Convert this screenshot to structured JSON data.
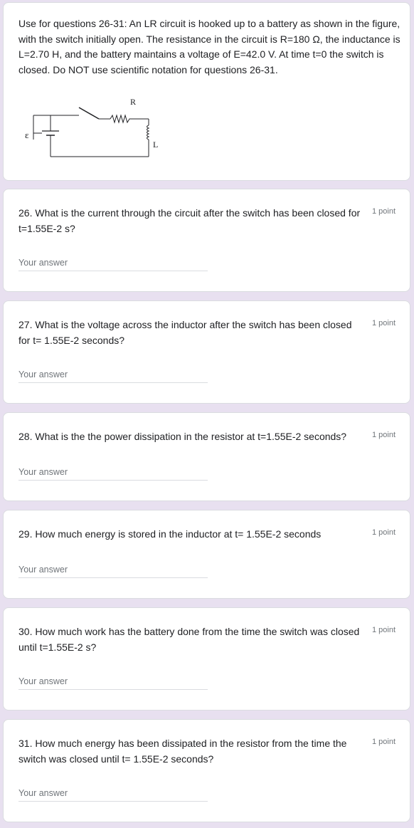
{
  "intro": {
    "text": "Use for questions 26-31:  An LR circuit is hooked up to a battery as shown in the figure, with the switch initially open. The resistance in the circuit is R=180 Ω, the inductance is L=2.70 H, and the battery maintains a voltage of E=42.0 V. At time t=0 the switch is closed.  Do NOT use scientific notation for questions 26-31.",
    "figure": {
      "resistor_label": "R",
      "inductor_label": "L",
      "emf_label": "ε"
    }
  },
  "answer_placeholder": "Your answer",
  "questions": [
    {
      "text": "26.  What is the current through the circuit after the switch has been closed for t=1.55E-2 s?",
      "points": "1 point"
    },
    {
      "text": "27.  What is the voltage across the inductor after the switch has been closed for t= 1.55E-2 seconds?",
      "points": "1 point"
    },
    {
      "text": "28.  What is the the power dissipation in the resistor at t=1.55E-2 seconds?",
      "points": "1 point"
    },
    {
      "text": "29.  How much energy is stored in the inductor at t= 1.55E-2 seconds",
      "points": "1 point"
    },
    {
      "text": "30.  How much work has the battery done from the time the switch was closed until t=1.55E-2 s?",
      "points": "1 point"
    },
    {
      "text": "31.  How much energy has been dissipated in the resistor from the time the switch was closed until t= 1.55E-2 seconds?",
      "points": "1 point"
    }
  ]
}
